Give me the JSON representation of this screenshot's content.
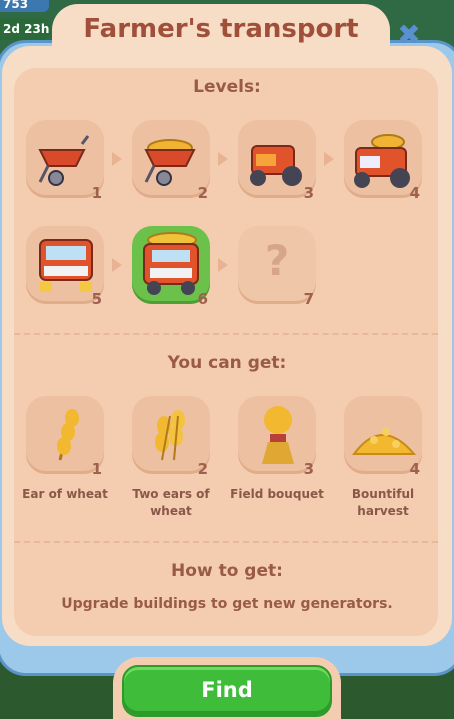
{
  "hud": {
    "counter_top": "753",
    "timer": "2d 23h"
  },
  "dialog": {
    "title": "Farmer's transport",
    "close_icon": "close-icon",
    "levels_heading": "Levels:",
    "levels": [
      {
        "number": "1",
        "item": "wheelbarrow"
      },
      {
        "number": "2",
        "item": "wheelbarrow-with-hay"
      },
      {
        "number": "3",
        "item": "tractor"
      },
      {
        "number": "4",
        "item": "tractor-with-hay"
      },
      {
        "number": "5",
        "item": "truck"
      },
      {
        "number": "6",
        "item": "truck-with-hay",
        "current": true
      },
      {
        "number": "7",
        "item": "unknown",
        "locked_symbol": "?"
      }
    ],
    "can_get_heading": "You can get:",
    "products": [
      {
        "number": "1",
        "label": "Ear of wheat"
      },
      {
        "number": "2",
        "label": "Two ears of wheat"
      },
      {
        "number": "3",
        "label": "Field bouquet"
      },
      {
        "number": "4",
        "label": "Bountiful harvest"
      }
    ],
    "how_heading": "How to get:",
    "how_text": "Upgrade buildings to get new generators.",
    "find_label": "Find"
  },
  "colors": {
    "title": "#a0503a",
    "panel": "#f7dcc6",
    "active_tile": "#6cc14a",
    "find_button": "#3fbc3a"
  }
}
